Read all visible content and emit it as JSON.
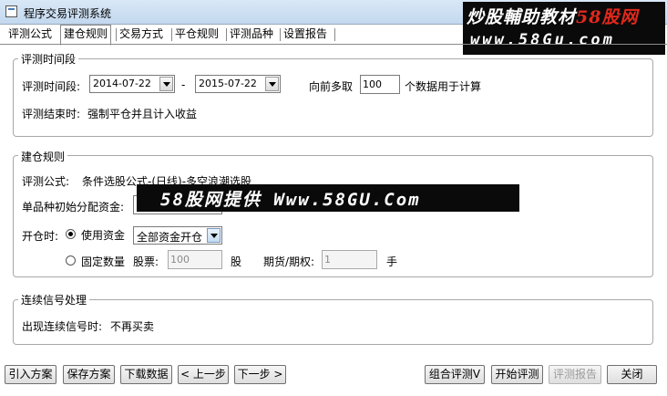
{
  "window": {
    "title": "程序交易评测系统"
  },
  "watermark": {
    "banner_part1": "炒股輔助教材",
    "banner_part2": "58股网",
    "banner_line2": "www.58Gu.com",
    "center": "58股网提供 Www.58GU.Com"
  },
  "tabs": [
    {
      "label": "评测公式",
      "active": false
    },
    {
      "label": "建仓规则",
      "active": true
    },
    {
      "label": "交易方式",
      "active": false
    },
    {
      "label": "平仓规则",
      "active": false
    },
    {
      "label": "评测品种",
      "active": false
    },
    {
      "label": "设置报告",
      "active": false
    }
  ],
  "period": {
    "legend": "评测时间段",
    "label": "评测时间段:",
    "start_date": "2014-07-22",
    "dash": "-",
    "end_date": "2015-07-22",
    "lookback_label": "向前多取",
    "lookback_value": "100",
    "lookback_suffix": "个数据用于计算",
    "end_label": "评测结束时:",
    "end_value": "强制平仓并且计入收益"
  },
  "open_rules": {
    "legend": "建仓规则",
    "formula_label": "评测公式:",
    "formula_value": "条件选股公式-(日线)-多空浪潮选股",
    "capital_label": "单品种初始分配资金:",
    "capital_value": "",
    "open_label": "开仓时:",
    "use_capital_label": "使用资金",
    "use_capital_selected": true,
    "use_capital_option": "全部资金开仓",
    "fixed_qty_label": "固定数量",
    "fixed_qty_selected": false,
    "stock_label": "股票:",
    "stock_value": "100",
    "stock_unit": "股",
    "futures_label": "期货/期权:",
    "futures_value": "1",
    "futures_unit": "手"
  },
  "signals": {
    "legend": "连续信号处理",
    "label": "出现连续信号时:",
    "value": "不再买卖"
  },
  "buttons": {
    "import": "引入方案",
    "save": "保存方案",
    "download": "下载数据",
    "prev": "< 上一步",
    "next": "下一步 >",
    "combo": "组合评测V",
    "start": "开始评测",
    "report": "评测报告",
    "close": "关闭"
  }
}
